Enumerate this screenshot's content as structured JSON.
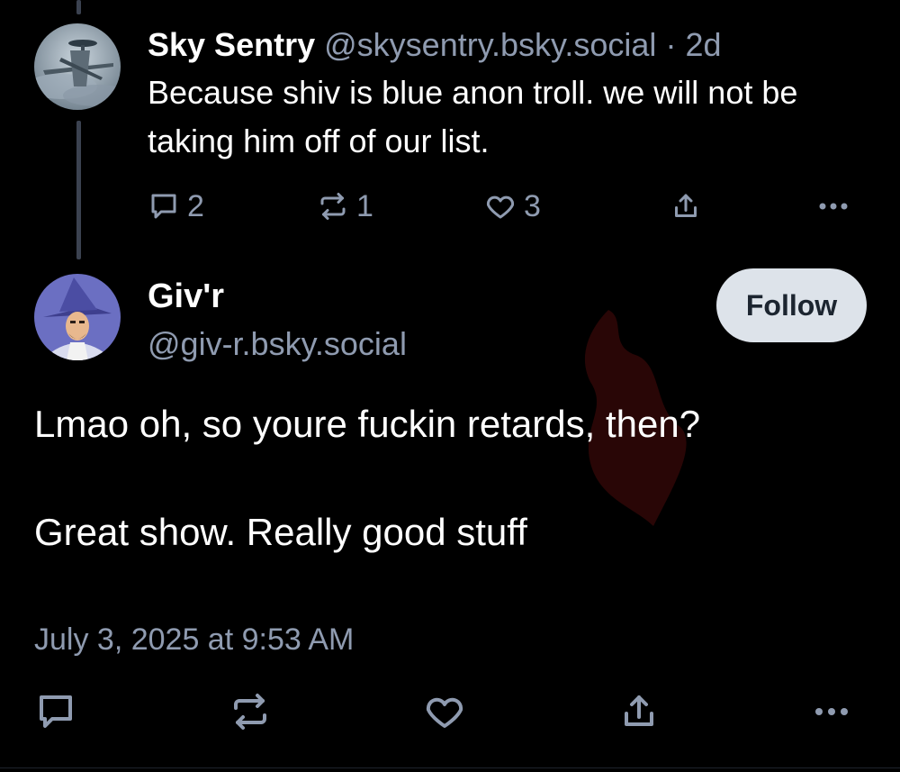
{
  "reply": {
    "author_name": "Sky Sentry",
    "author_handle": "@skysentry.bsky.social",
    "separator": "·",
    "age": "2d",
    "text": "Because shiv is blue anon troll. we will not be taking him off of our list.",
    "reply_count": "2",
    "repost_count": "1",
    "like_count": "3"
  },
  "post": {
    "author_name": "Giv'r",
    "author_handle": "@giv-r.bsky.social",
    "follow_label": "Follow",
    "text_line_1": "Lmao oh, so youre fuckin retards, then?",
    "text_line_2": "Great show. Really good stuff",
    "timestamp": "July 3, 2025 at 9:53 AM"
  },
  "icons": {
    "reply": "speech-bubble",
    "repost": "repost-arrows",
    "like": "heart",
    "share": "share-upload",
    "more": "ellipsis"
  },
  "colors": {
    "background": "#000000",
    "muted_text": "#8f9bb0",
    "follow_button_bg": "#dde3ea"
  }
}
